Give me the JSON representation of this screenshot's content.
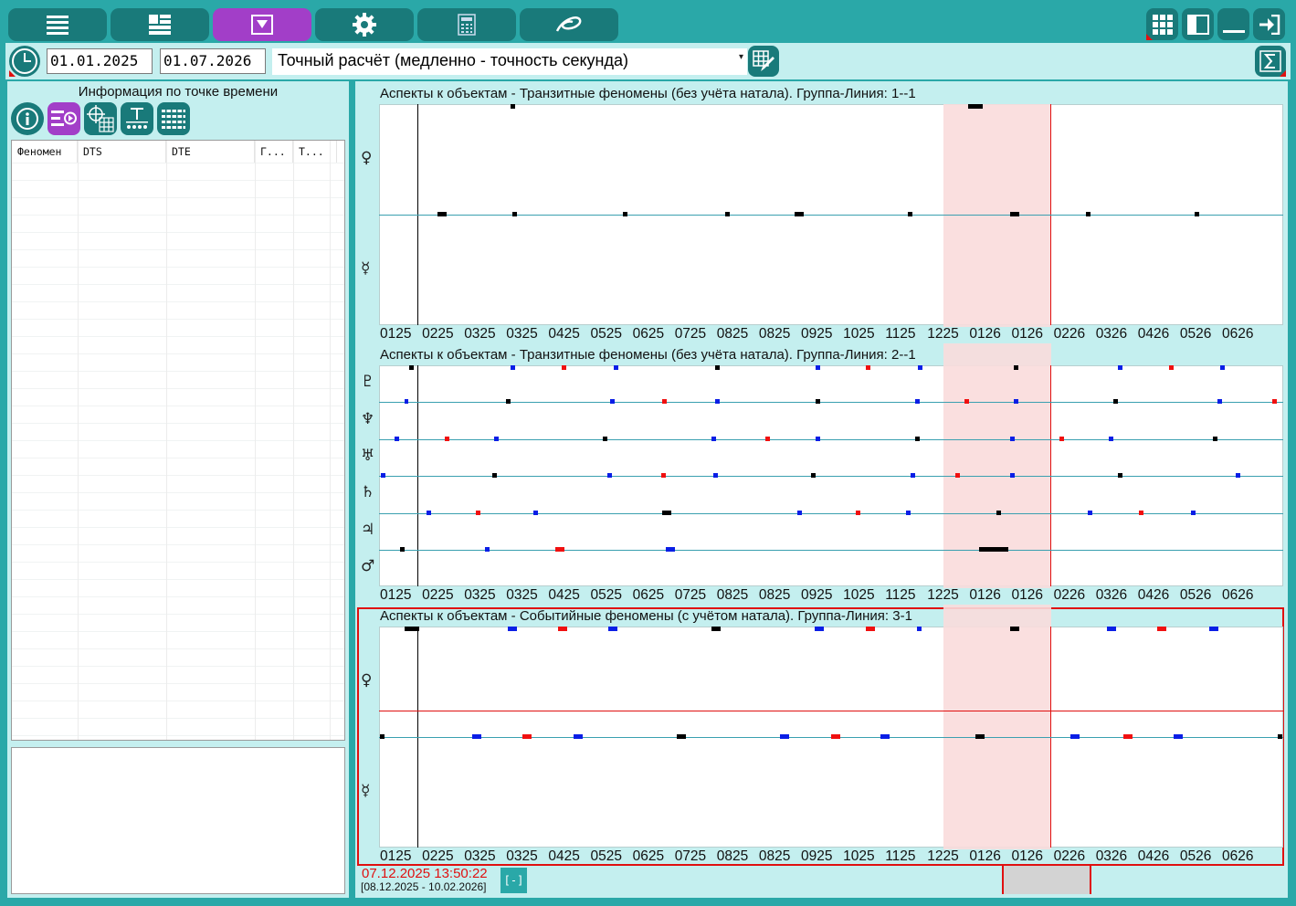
{
  "toolbar": {
    "buttons": [
      {
        "name": "menu-list-icon"
      },
      {
        "name": "dashboard-icon"
      },
      {
        "name": "filter-down-icon",
        "active": true
      },
      {
        "name": "gear-icon"
      },
      {
        "name": "calculator-icon"
      },
      {
        "name": "swirl-logo-icon"
      }
    ],
    "right_buttons": [
      "grid-icon",
      "panel-toggle-icon",
      "minimize-icon",
      "exit-icon"
    ]
  },
  "controls": {
    "date_start": "01.01.2025",
    "date_end": "01.07.2026",
    "calc_mode": "Точный расчёт (медленно - точность секунда)"
  },
  "left_panel": {
    "title": "Информация по точке времени",
    "tools": [
      "info-icon",
      "list-arrow-icon",
      "crosshair-grid-icon",
      "text-dots-icon",
      "barcode-list-icon"
    ],
    "columns": [
      "Феномен",
      "DTS",
      "DTE",
      "Г...",
      "Т..."
    ]
  },
  "colors": {
    "teal": "#2aa8a8",
    "dark_teal": "#197a7a",
    "light_teal": "#c4efef",
    "purple": "#a23ec8",
    "blue": "#0a1ee6",
    "red": "#f01010",
    "highlight": "#f9dcdc"
  },
  "x_ticks": [
    "0125",
    "0225",
    "0325",
    "0325",
    "0425",
    "0525",
    "0625",
    "0725",
    "0825",
    "0825",
    "0925",
    "1025",
    "1125",
    "1225",
    "0126",
    "0126",
    "0226",
    "0326",
    "0426",
    "0526",
    "0626"
  ],
  "charts": [
    {
      "title": "Аспекты к объектам - Транзитные феномены (без учёта натала). Группа-Линия: 1--1",
      "planets": [
        "♀",
        "☿"
      ],
      "marks": [
        [
          0.148,
          0,
          "k",
          1
        ],
        [
          0.66,
          0,
          "k",
          3
        ],
        [
          0.07,
          1,
          "k",
          2
        ],
        [
          0.15,
          1,
          "k",
          1
        ],
        [
          0.272,
          1,
          "k",
          1
        ],
        [
          0.385,
          1,
          "k",
          1
        ],
        [
          0.465,
          1,
          "k",
          2
        ],
        [
          0.587,
          1,
          "k",
          1
        ],
        [
          0.703,
          1,
          "k",
          2
        ],
        [
          0.784,
          1,
          "k",
          1
        ],
        [
          0.905,
          1,
          "k",
          1
        ]
      ]
    },
    {
      "title": "Аспекты к объектам - Транзитные феномены (без учёта натала). Группа-Линия: 2--1",
      "planets": [
        "♇",
        "♆",
        "♅",
        "♄",
        "♃",
        "♂"
      ],
      "marks": [
        [
          0.036,
          0,
          "k",
          1
        ],
        [
          0.148,
          0,
          "b",
          1
        ],
        [
          0.205,
          0,
          "r",
          1
        ],
        [
          0.262,
          0,
          "b",
          1
        ],
        [
          0.374,
          0,
          "k",
          1
        ],
        [
          0.485,
          0,
          "b",
          1
        ],
        [
          0.541,
          0,
          "r",
          1
        ],
        [
          0.598,
          0,
          "b",
          1
        ],
        [
          0.705,
          0,
          "k",
          1
        ],
        [
          0.82,
          0,
          "b",
          1
        ],
        [
          0.876,
          0,
          "r",
          1
        ],
        [
          0.933,
          0,
          "b",
          1
        ],
        [
          0.03,
          1,
          "b",
          0
        ],
        [
          0.143,
          1,
          "k",
          1
        ],
        [
          0.258,
          1,
          "b",
          1
        ],
        [
          0.316,
          1,
          "r",
          1
        ],
        [
          0.374,
          1,
          "b",
          1
        ],
        [
          0.485,
          1,
          "k",
          1
        ],
        [
          0.595,
          1,
          "b",
          1
        ],
        [
          0.65,
          1,
          "r",
          1
        ],
        [
          0.705,
          1,
          "b",
          1
        ],
        [
          0.815,
          1,
          "k",
          1
        ],
        [
          0.93,
          1,
          "b",
          1
        ],
        [
          0.99,
          1,
          "r",
          1
        ],
        [
          0.02,
          2,
          "b",
          1
        ],
        [
          0.075,
          2,
          "r",
          1
        ],
        [
          0.13,
          2,
          "b",
          1
        ],
        [
          0.25,
          2,
          "k",
          1
        ],
        [
          0.37,
          2,
          "b",
          1
        ],
        [
          0.43,
          2,
          "r",
          1
        ],
        [
          0.485,
          2,
          "b",
          1
        ],
        [
          0.595,
          2,
          "k",
          1
        ],
        [
          0.7,
          2,
          "b",
          1
        ],
        [
          0.755,
          2,
          "r",
          1
        ],
        [
          0.81,
          2,
          "b",
          1
        ],
        [
          0.925,
          2,
          "k",
          1
        ],
        [
          0.005,
          3,
          "b",
          1
        ],
        [
          0.128,
          3,
          "k",
          1
        ],
        [
          0.255,
          3,
          "b",
          1
        ],
        [
          0.315,
          3,
          "r",
          1
        ],
        [
          0.372,
          3,
          "b",
          1
        ],
        [
          0.48,
          3,
          "k",
          1
        ],
        [
          0.59,
          3,
          "b",
          1
        ],
        [
          0.64,
          3,
          "r",
          1
        ],
        [
          0.7,
          3,
          "b",
          1
        ],
        [
          0.82,
          3,
          "k",
          1
        ],
        [
          0.95,
          3,
          "b",
          1
        ],
        [
          0.055,
          4,
          "b",
          1
        ],
        [
          0.11,
          4,
          "r",
          1
        ],
        [
          0.173,
          4,
          "b",
          1
        ],
        [
          0.318,
          4,
          "k",
          2
        ],
        [
          0.465,
          4,
          "b",
          1
        ],
        [
          0.53,
          4,
          "r",
          1
        ],
        [
          0.585,
          4,
          "b",
          1
        ],
        [
          0.685,
          4,
          "k",
          1
        ],
        [
          0.786,
          4,
          "b",
          1
        ],
        [
          0.843,
          4,
          "r",
          1
        ],
        [
          0.9,
          4,
          "b",
          1
        ],
        [
          0.026,
          5,
          "k",
          1
        ],
        [
          0.12,
          5,
          "b",
          1
        ],
        [
          0.2,
          5,
          "r",
          2
        ],
        [
          0.322,
          5,
          "b",
          2
        ],
        [
          0.68,
          5,
          "k",
          4
        ]
      ]
    },
    {
      "title": "Аспекты к объектам - Событийные феномены (с учётом натала). Группа-Линия: 3-1",
      "planets": [
        "♀",
        "☿"
      ],
      "marks": [
        [
          0.036,
          0,
          "k",
          3
        ],
        [
          0.147,
          0,
          "b",
          2
        ],
        [
          0.203,
          0,
          "r",
          2
        ],
        [
          0.259,
          0,
          "b",
          2
        ],
        [
          0.373,
          0,
          "k",
          2
        ],
        [
          0.487,
          0,
          "b",
          2
        ],
        [
          0.543,
          0,
          "r",
          2
        ],
        [
          0.597,
          0,
          "b",
          1
        ],
        [
          0.703,
          0,
          "k",
          2
        ],
        [
          0.81,
          0,
          "b",
          2
        ],
        [
          0.866,
          0,
          "r",
          2
        ],
        [
          0.923,
          0,
          "b",
          2
        ],
        [
          0.004,
          1,
          "k",
          1
        ],
        [
          0.108,
          1,
          "b",
          2
        ],
        [
          0.164,
          1,
          "r",
          2
        ],
        [
          0.22,
          1,
          "b",
          2
        ],
        [
          0.334,
          1,
          "k",
          2
        ],
        [
          0.448,
          1,
          "b",
          2
        ],
        [
          0.505,
          1,
          "r",
          2
        ],
        [
          0.56,
          1,
          "b",
          2
        ],
        [
          0.665,
          1,
          "k",
          2
        ],
        [
          0.77,
          1,
          "b",
          2
        ],
        [
          0.828,
          1,
          "r",
          2
        ],
        [
          0.884,
          1,
          "b",
          2
        ],
        [
          0.996,
          1,
          "k",
          1
        ]
      ]
    }
  ],
  "status": {
    "current_time": "07.12.2025 13:50:22",
    "range": "[08.12.2025 - 10.02.2026]",
    "collapse_label": "[-]"
  }
}
